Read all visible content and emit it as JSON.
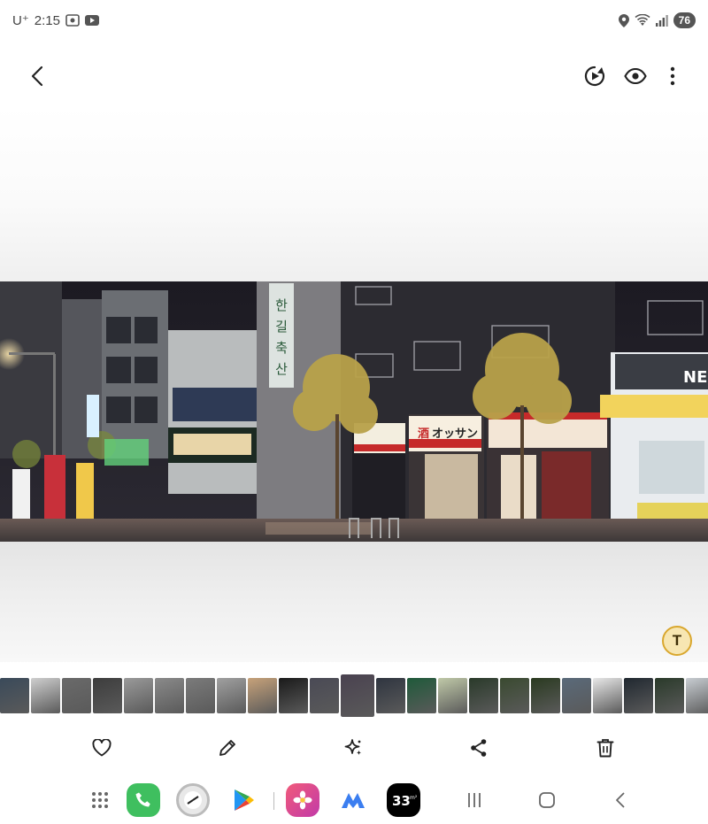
{
  "status_bar": {
    "carrier": "U⁺",
    "time": "2:15",
    "battery": "76"
  },
  "icons": {
    "back": "back-arrow-icon",
    "motion_photo": "motion-photo-play-icon",
    "view": "eye-icon",
    "more": "more-vert-icon",
    "text_extract": "text-extract-icon",
    "favorite": "heart-icon",
    "edit": "pencil-icon",
    "ai_edit": "sparkle-icon",
    "share": "share-icon",
    "delete": "trash-icon"
  },
  "text_fab": {
    "label": "T"
  },
  "storefront_signs": {
    "vertical_sign": "한길축산",
    "shop_banner": "オッサン",
    "shop_banner_prefix": "酒",
    "right_sign": "NE"
  },
  "filmstrip": {
    "active_index": 11,
    "thumbnail_colors": [
      "#3a4a5a",
      "#cfcfcf",
      "#6a6a6a",
      "#3d3d3d",
      "#9a9a9a",
      "#8a8a8a",
      "#7b7b7b",
      "#a0a0a0",
      "#c7a27a",
      "#1a1a1a",
      "#4a4a55",
      "#4a4250",
      "#2f3540",
      "#1f5a3a",
      "#c0c9a8",
      "#2a3a2a",
      "#3a4a30",
      "#2a3a20",
      "#5a6a7a",
      "#e8e8e8",
      "#202830",
      "#2a3a2a",
      "#c8cdd2"
    ]
  },
  "dock": {
    "apps": [
      {
        "name": "app-drawer",
        "color": "#666666"
      },
      {
        "name": "phone",
        "color": "#3fbf5f"
      },
      {
        "name": "clock",
        "color": "#e8e8e8"
      },
      {
        "name": "play-store",
        "color": "#ffffff"
      },
      {
        "name": "gallery",
        "color": "#e8488a"
      },
      {
        "name": "m-app",
        "color": "#3b7ef0"
      },
      {
        "name": "33-app",
        "color": "#000000"
      }
    ]
  },
  "colors": {
    "accent": "#d9a72e",
    "icon": "#222222"
  }
}
